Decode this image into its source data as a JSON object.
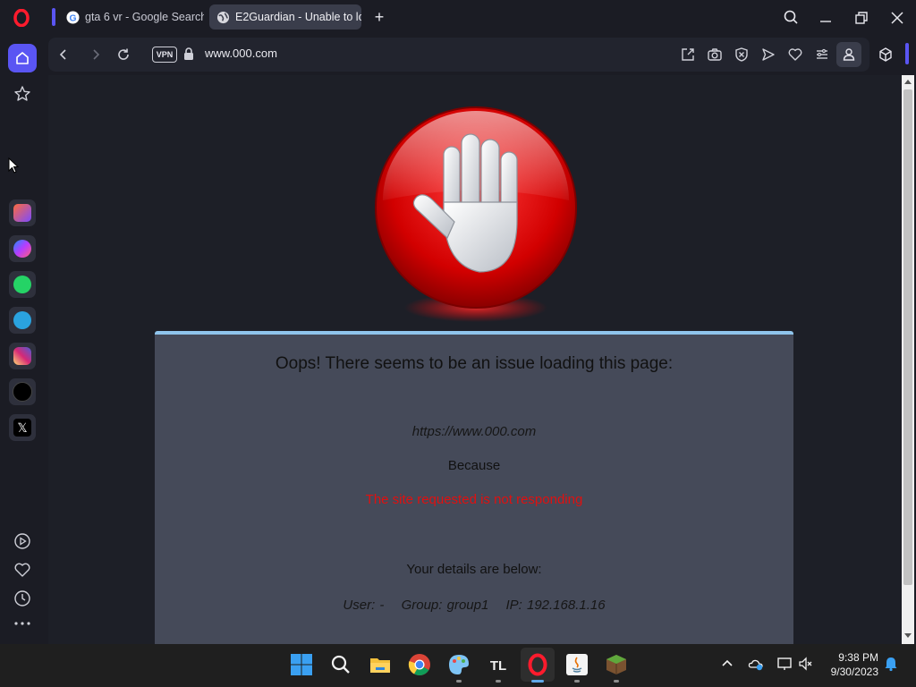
{
  "browser": {
    "tabs": [
      {
        "title": "gta 6 vr - Google Search",
        "icon": "google-icon",
        "active": false
      },
      {
        "title": "E2Guardian - Unable to lo",
        "icon": "globe-icon",
        "active": true
      }
    ],
    "accent_color": "#5a55f3"
  },
  "address_bar": {
    "vpn_label": "VPN",
    "url": "www.000.com"
  },
  "sidebar": {
    "apps": [
      "aria-icon",
      "messenger-icon",
      "whatsapp-icon",
      "telegram-icon",
      "instagram-icon",
      "tiktok-icon",
      "x-icon"
    ],
    "bottom": [
      "player-icon",
      "heart-icon",
      "history-icon",
      "more-icon"
    ]
  },
  "page": {
    "title": "Oops! There seems to be an issue loading this page:",
    "blocked_url": "https://www.000.com",
    "because": "Because",
    "reason": "The site requested is not responding",
    "details_heading": "Your details are below:",
    "user": "User: -",
    "group": "Group: group1",
    "ip": "IP: 192.168.1.16",
    "reason_color": "#e01010",
    "card_accent": "#8fc4ec"
  },
  "taskbar": {
    "apps": [
      "windows-start-icon",
      "search-icon",
      "file-explorer-icon",
      "chrome-icon",
      "paint-icon",
      "tlauncher-icon",
      "opera-icon",
      "java-icon",
      "minecraft-icon"
    ],
    "time": "9:38 PM",
    "date": "9/30/2023"
  }
}
